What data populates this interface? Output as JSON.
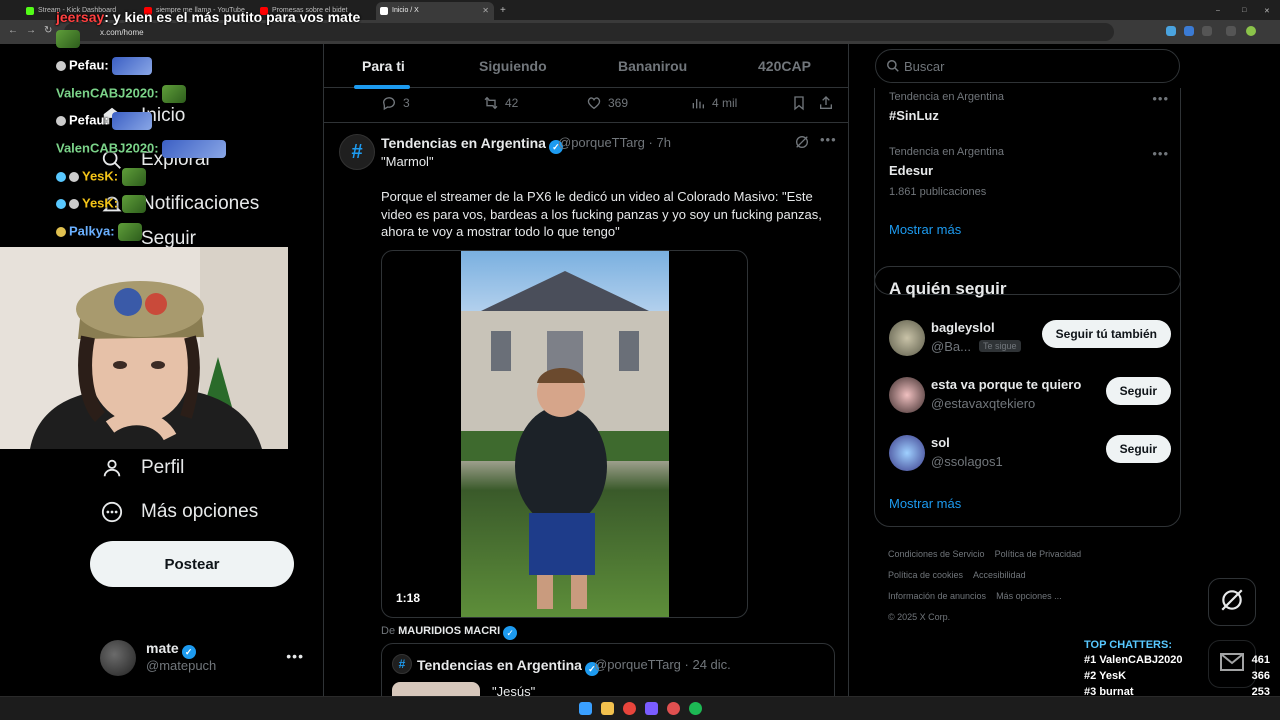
{
  "browser": {
    "tabs": [
      {
        "title": "Stream - Kick Dashboard",
        "color": "#53fc18"
      },
      {
        "title": "siempre me llama - YouTube",
        "color": "#ff0000"
      },
      {
        "title": "Promesas sobre el bidet",
        "color": "#ff0000"
      },
      {
        "title": "Inicio / X",
        "color": "#ffffff"
      }
    ],
    "url": "x.com/home"
  },
  "chat_overlay": {
    "top_message": {
      "user": "jeersay",
      "text": ": y kien es el más putito para vos mate"
    },
    "lines": [
      {
        "user": "Pefau:",
        "color": "#ffffff"
      },
      {
        "user": "ValenCABJ2020:",
        "color": "#7bd389"
      },
      {
        "user": "Pefau:",
        "color": "#ffffff"
      },
      {
        "user": "ValenCABJ2020:",
        "color": "#7bd389"
      },
      {
        "user": "YesK:",
        "color": "#f5c518"
      },
      {
        "user": "YesK:",
        "color": "#f5c518"
      },
      {
        "user": "Palkya:",
        "color": "#6ab0ff"
      }
    ]
  },
  "sidebar": {
    "nav": [
      {
        "label": "Inicio",
        "icon": "home-icon"
      },
      {
        "label": "Explorar",
        "icon": "search-icon"
      },
      {
        "label": "Notificaciones",
        "icon": "bell-icon"
      },
      {
        "label": "Seguir",
        "icon": "follow-icon"
      },
      {
        "label": "Perfil",
        "icon": "person-icon"
      },
      {
        "label": "Más opciones",
        "icon": "more-icon"
      }
    ],
    "post_button": "Postear",
    "account": {
      "name": "mate",
      "handle": "@matepuch"
    }
  },
  "timeline": {
    "tabs": [
      "Para ti",
      "Siguiendo",
      "Bananirou",
      "420CAP"
    ],
    "active_tab": "Para ti",
    "prev_actions": {
      "replies": "3",
      "reposts": "42",
      "likes": "369",
      "views": "4 mil"
    },
    "tweet": {
      "name": "Tendencias en Argentina",
      "handle": "@porqueTTarg",
      "time": "· 7h",
      "title": "\"Marmol\"",
      "body": "Porque el streamer de la PX6 le dedicó un video al Colorado Masivo: \"Este video es para vos, bardeas a los fucking panzas y yo soy un fucking panzas, ahora te voy a mostrar todo lo que tengo\"",
      "video_duration": "1:18",
      "quote_from_prefix": "De",
      "quote_from_name": "MAURIDIOS MACRI",
      "quote": {
        "name": "Tendencias en Argentina",
        "handle": "@porqueTTarg",
        "time": "· 24 dic.",
        "text": "\"Jesús\""
      }
    }
  },
  "right": {
    "search_placeholder": "Buscar",
    "trends": [
      {
        "context": "Tendencia en Argentina",
        "title": "#SinLuz",
        "count": ""
      },
      {
        "context": "Tendencia en Argentina",
        "title": "Edesur",
        "count": "1.861 publicaciones"
      }
    ],
    "trends_show_more": "Mostrar más",
    "who_to_follow": {
      "title": "A quién seguir",
      "users": [
        {
          "name": "bagleyslol",
          "handle": "@Ba...",
          "badge": "Te sigue",
          "button": "Seguir tú también"
        },
        {
          "name": "esta va porque te quiero",
          "handle": "@estavaxqtekiero",
          "badge": "",
          "button": "Seguir"
        },
        {
          "name": "sol",
          "handle": "@ssolagos1",
          "badge": "",
          "button": "Seguir"
        }
      ],
      "show_more": "Mostrar más"
    },
    "footer": [
      "Condiciones de Servicio",
      "Política de Privacidad",
      "Política de cookies",
      "Accesibilidad",
      "Información de anuncios",
      "Más opciones ...",
      "© 2025 X Corp."
    ]
  },
  "top_chatters": {
    "title": "TOP CHATTERS:",
    "rows": [
      {
        "rank": "#1",
        "name": "ValenCABJ2020",
        "count": "461"
      },
      {
        "rank": "#2",
        "name": "YesK",
        "count": "366"
      },
      {
        "rank": "#3",
        "name": "burnat",
        "count": "253"
      }
    ]
  },
  "colors": {
    "accent": "#1d9bf0",
    "bg": "#000000",
    "border": "#2f3336",
    "muted": "#71767b"
  }
}
